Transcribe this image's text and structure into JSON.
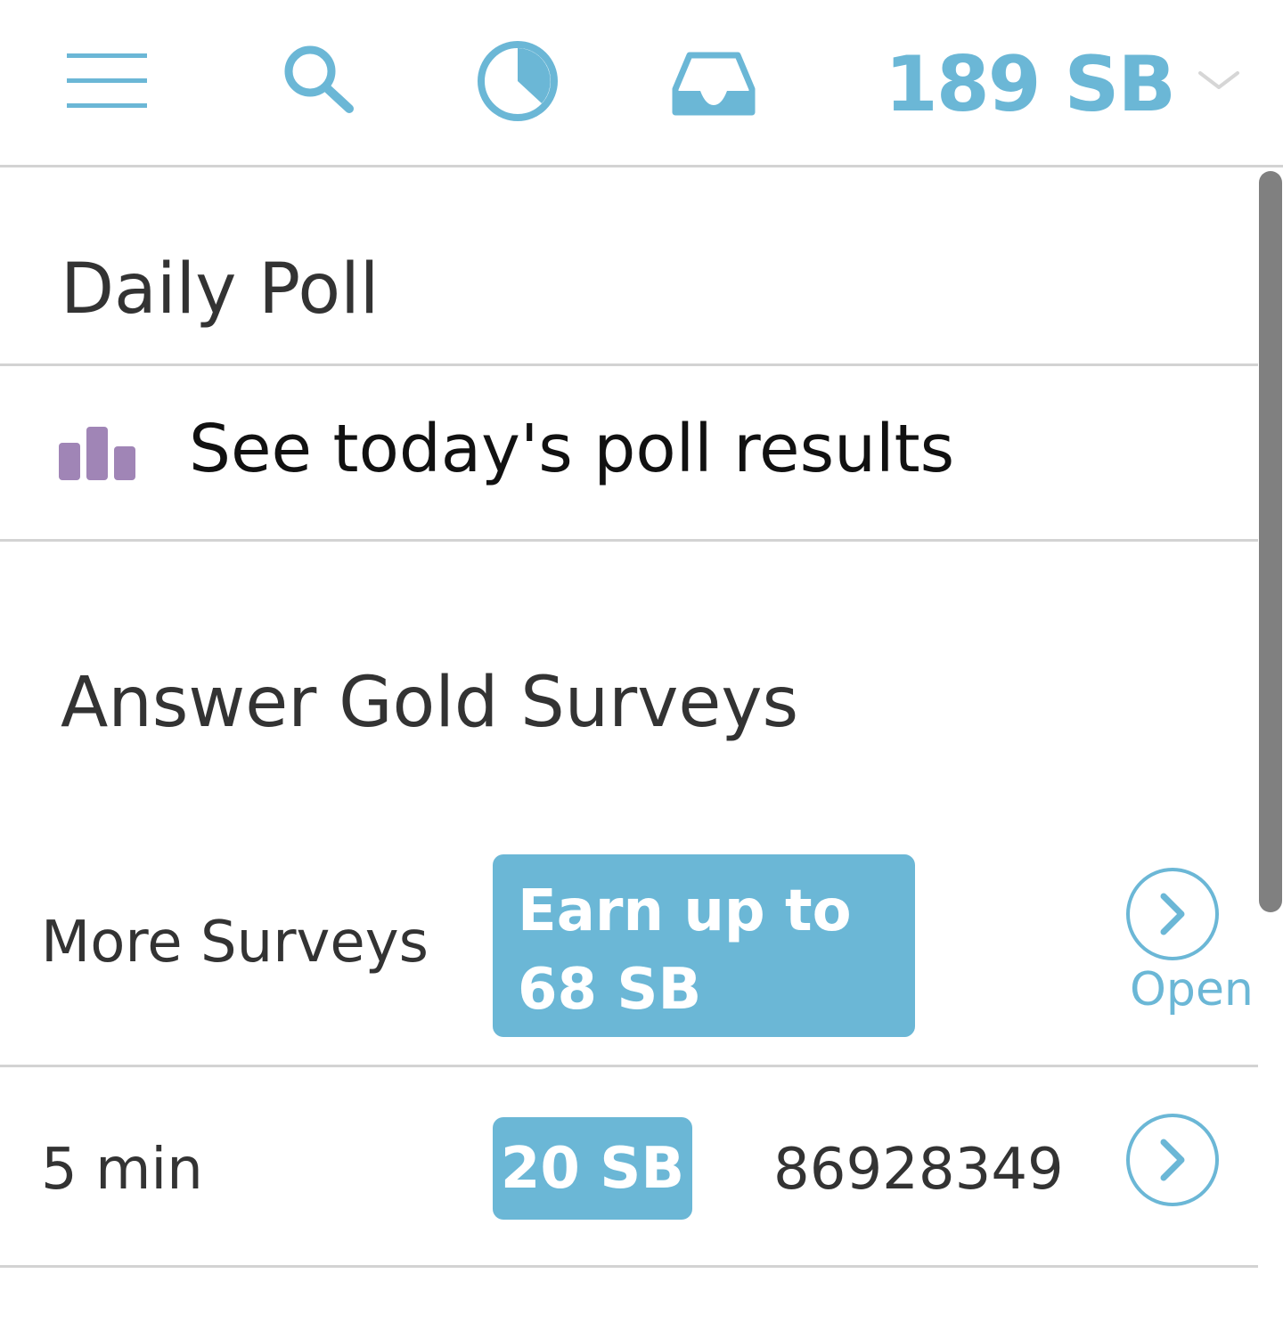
{
  "header": {
    "menu_icon": "hamburger-menu-icon",
    "search_icon": "search-icon",
    "activity_icon": "pie-clock-icon",
    "inbox_icon": "inbox-tray-icon",
    "balance": "189 SB",
    "balance_chevron": "chevron-down-icon",
    "accent_color": "#6bb7d6"
  },
  "daily_poll": {
    "title": "Daily Poll",
    "results_label": "See today's poll results",
    "results_icon": "bar-chart-icon",
    "icon_color": "#a085b6"
  },
  "gold_surveys": {
    "title": "Answer Gold Surveys",
    "more": {
      "label": "More Surveys",
      "badge_line1": "Earn up to",
      "badge_line2": "68 SB",
      "action_label": "Open"
    },
    "rows": [
      {
        "duration": "5 min",
        "reward": "20 SB",
        "id": "86928349"
      }
    ]
  }
}
